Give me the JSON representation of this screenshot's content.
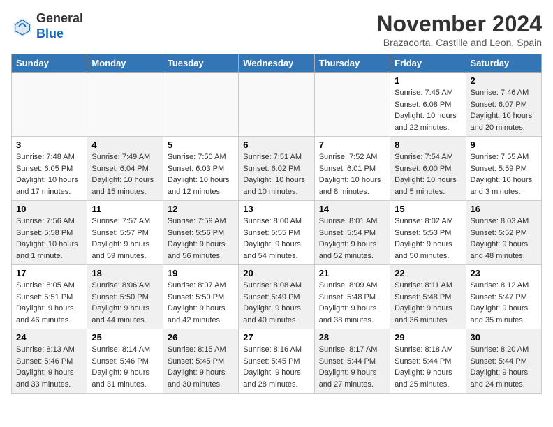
{
  "logo": {
    "line1": "General",
    "line2": "Blue"
  },
  "title": "November 2024",
  "subtitle": "Brazacorta, Castille and Leon, Spain",
  "days_of_week": [
    "Sunday",
    "Monday",
    "Tuesday",
    "Wednesday",
    "Thursday",
    "Friday",
    "Saturday"
  ],
  "weeks": [
    [
      {
        "day": "",
        "info": "",
        "shaded": true
      },
      {
        "day": "",
        "info": "",
        "shaded": true
      },
      {
        "day": "",
        "info": "",
        "shaded": true
      },
      {
        "day": "",
        "info": "",
        "shaded": true
      },
      {
        "day": "",
        "info": "",
        "shaded": true
      },
      {
        "day": "1",
        "info": "Sunrise: 7:45 AM\nSunset: 6:08 PM\nDaylight: 10 hours\nand 22 minutes.",
        "shaded": false
      },
      {
        "day": "2",
        "info": "Sunrise: 7:46 AM\nSunset: 6:07 PM\nDaylight: 10 hours\nand 20 minutes.",
        "shaded": true
      }
    ],
    [
      {
        "day": "3",
        "info": "Sunrise: 7:48 AM\nSunset: 6:05 PM\nDaylight: 10 hours\nand 17 minutes.",
        "shaded": false
      },
      {
        "day": "4",
        "info": "Sunrise: 7:49 AM\nSunset: 6:04 PM\nDaylight: 10 hours\nand 15 minutes.",
        "shaded": true
      },
      {
        "day": "5",
        "info": "Sunrise: 7:50 AM\nSunset: 6:03 PM\nDaylight: 10 hours\nand 12 minutes.",
        "shaded": false
      },
      {
        "day": "6",
        "info": "Sunrise: 7:51 AM\nSunset: 6:02 PM\nDaylight: 10 hours\nand 10 minutes.",
        "shaded": true
      },
      {
        "day": "7",
        "info": "Sunrise: 7:52 AM\nSunset: 6:01 PM\nDaylight: 10 hours\nand 8 minutes.",
        "shaded": false
      },
      {
        "day": "8",
        "info": "Sunrise: 7:54 AM\nSunset: 6:00 PM\nDaylight: 10 hours\nand 5 minutes.",
        "shaded": true
      },
      {
        "day": "9",
        "info": "Sunrise: 7:55 AM\nSunset: 5:59 PM\nDaylight: 10 hours\nand 3 minutes.",
        "shaded": false
      }
    ],
    [
      {
        "day": "10",
        "info": "Sunrise: 7:56 AM\nSunset: 5:58 PM\nDaylight: 10 hours\nand 1 minute.",
        "shaded": true
      },
      {
        "day": "11",
        "info": "Sunrise: 7:57 AM\nSunset: 5:57 PM\nDaylight: 9 hours\nand 59 minutes.",
        "shaded": false
      },
      {
        "day": "12",
        "info": "Sunrise: 7:59 AM\nSunset: 5:56 PM\nDaylight: 9 hours\nand 56 minutes.",
        "shaded": true
      },
      {
        "day": "13",
        "info": "Sunrise: 8:00 AM\nSunset: 5:55 PM\nDaylight: 9 hours\nand 54 minutes.",
        "shaded": false
      },
      {
        "day": "14",
        "info": "Sunrise: 8:01 AM\nSunset: 5:54 PM\nDaylight: 9 hours\nand 52 minutes.",
        "shaded": true
      },
      {
        "day": "15",
        "info": "Sunrise: 8:02 AM\nSunset: 5:53 PM\nDaylight: 9 hours\nand 50 minutes.",
        "shaded": false
      },
      {
        "day": "16",
        "info": "Sunrise: 8:03 AM\nSunset: 5:52 PM\nDaylight: 9 hours\nand 48 minutes.",
        "shaded": true
      }
    ],
    [
      {
        "day": "17",
        "info": "Sunrise: 8:05 AM\nSunset: 5:51 PM\nDaylight: 9 hours\nand 46 minutes.",
        "shaded": false
      },
      {
        "day": "18",
        "info": "Sunrise: 8:06 AM\nSunset: 5:50 PM\nDaylight: 9 hours\nand 44 minutes.",
        "shaded": true
      },
      {
        "day": "19",
        "info": "Sunrise: 8:07 AM\nSunset: 5:50 PM\nDaylight: 9 hours\nand 42 minutes.",
        "shaded": false
      },
      {
        "day": "20",
        "info": "Sunrise: 8:08 AM\nSunset: 5:49 PM\nDaylight: 9 hours\nand 40 minutes.",
        "shaded": true
      },
      {
        "day": "21",
        "info": "Sunrise: 8:09 AM\nSunset: 5:48 PM\nDaylight: 9 hours\nand 38 minutes.",
        "shaded": false
      },
      {
        "day": "22",
        "info": "Sunrise: 8:11 AM\nSunset: 5:48 PM\nDaylight: 9 hours\nand 36 minutes.",
        "shaded": true
      },
      {
        "day": "23",
        "info": "Sunrise: 8:12 AM\nSunset: 5:47 PM\nDaylight: 9 hours\nand 35 minutes.",
        "shaded": false
      }
    ],
    [
      {
        "day": "24",
        "info": "Sunrise: 8:13 AM\nSunset: 5:46 PM\nDaylight: 9 hours\nand 33 minutes.",
        "shaded": true
      },
      {
        "day": "25",
        "info": "Sunrise: 8:14 AM\nSunset: 5:46 PM\nDaylight: 9 hours\nand 31 minutes.",
        "shaded": false
      },
      {
        "day": "26",
        "info": "Sunrise: 8:15 AM\nSunset: 5:45 PM\nDaylight: 9 hours\nand 30 minutes.",
        "shaded": true
      },
      {
        "day": "27",
        "info": "Sunrise: 8:16 AM\nSunset: 5:45 PM\nDaylight: 9 hours\nand 28 minutes.",
        "shaded": false
      },
      {
        "day": "28",
        "info": "Sunrise: 8:17 AM\nSunset: 5:44 PM\nDaylight: 9 hours\nand 27 minutes.",
        "shaded": true
      },
      {
        "day": "29",
        "info": "Sunrise: 8:18 AM\nSunset: 5:44 PM\nDaylight: 9 hours\nand 25 minutes.",
        "shaded": false
      },
      {
        "day": "30",
        "info": "Sunrise: 8:20 AM\nSunset: 5:44 PM\nDaylight: 9 hours\nand 24 minutes.",
        "shaded": true
      }
    ]
  ]
}
